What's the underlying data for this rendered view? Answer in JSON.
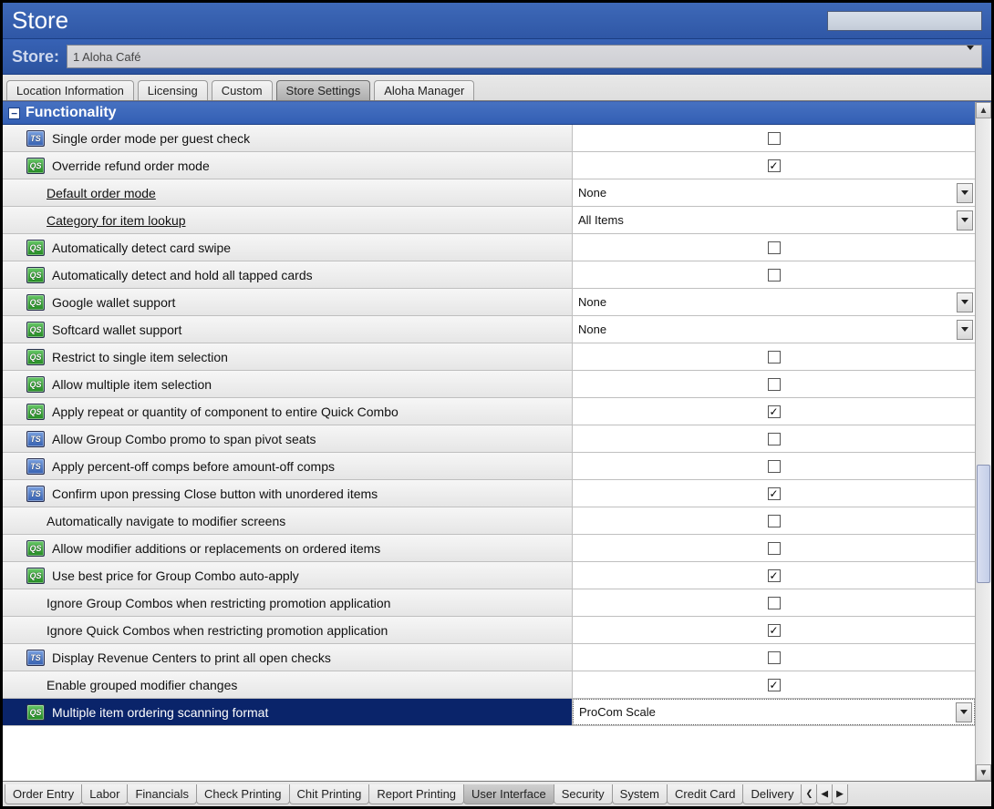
{
  "title": "Store",
  "store_label": "Store:",
  "store_value": "1 Aloha Café",
  "top_tabs": [
    "Location Information",
    "Licensing",
    "Custom",
    "Store Settings",
    "Aloha Manager"
  ],
  "top_tab_active": "Store Settings",
  "section": "Functionality",
  "rows": [
    {
      "icon": "ts",
      "label": "Single order mode per guest check",
      "type": "check",
      "checked": false
    },
    {
      "icon": "qs",
      "label": "Override refund order mode",
      "type": "check",
      "checked": true
    },
    {
      "icon": "",
      "label": "Default order mode",
      "link": true,
      "type": "select",
      "value": "None"
    },
    {
      "icon": "",
      "label": "Category for item lookup",
      "link": true,
      "type": "select",
      "value": "All Items"
    },
    {
      "icon": "qs",
      "label": "Automatically detect card swipe",
      "type": "check",
      "checked": false
    },
    {
      "icon": "qs",
      "label": "Automatically detect and hold all tapped cards",
      "type": "check",
      "checked": false
    },
    {
      "icon": "qs",
      "label": "Google wallet support",
      "type": "select",
      "value": "None"
    },
    {
      "icon": "qs",
      "label": "Softcard wallet support",
      "type": "select",
      "value": "None"
    },
    {
      "icon": "qs",
      "label": "Restrict to single item selection",
      "type": "check",
      "checked": false
    },
    {
      "icon": "qs",
      "label": "Allow multiple item selection",
      "type": "check",
      "checked": false
    },
    {
      "icon": "qs",
      "label": "Apply repeat or quantity of component to entire Quick Combo",
      "type": "check",
      "checked": true
    },
    {
      "icon": "ts",
      "label": "Allow Group Combo promo to span pivot seats",
      "type": "check",
      "checked": false
    },
    {
      "icon": "ts",
      "label": "Apply percent-off comps before amount-off comps",
      "type": "check",
      "checked": false
    },
    {
      "icon": "ts",
      "label": "Confirm upon pressing Close button with unordered items",
      "type": "check",
      "checked": true
    },
    {
      "icon": "",
      "label": "Automatically navigate to modifier screens",
      "type": "check",
      "checked": false
    },
    {
      "icon": "qs",
      "label": "Allow modifier additions or replacements on ordered items",
      "type": "check",
      "checked": false
    },
    {
      "icon": "qs",
      "label": "Use best price for Group Combo auto-apply",
      "type": "check",
      "checked": true
    },
    {
      "icon": "",
      "label": "Ignore Group Combos when restricting promotion application",
      "type": "check",
      "checked": false
    },
    {
      "icon": "",
      "label": "Ignore Quick Combos when restricting promotion application",
      "type": "check",
      "checked": true
    },
    {
      "icon": "ts",
      "label": "Display Revenue Centers to print all open checks",
      "type": "check",
      "checked": false
    },
    {
      "icon": "",
      "label": "Enable grouped modifier changes",
      "type": "check",
      "checked": true
    },
    {
      "icon": "qs",
      "label": "Multiple item ordering scanning format",
      "type": "select",
      "value": "ProCom Scale",
      "selected": true
    }
  ],
  "bottom_tabs": [
    "Order Entry",
    "Labor",
    "Financials",
    "Check Printing",
    "Chit Printing",
    "Report Printing",
    "User Interface",
    "Security",
    "System",
    "Credit Card",
    "Delivery"
  ],
  "bottom_tab_active": "User Interface"
}
